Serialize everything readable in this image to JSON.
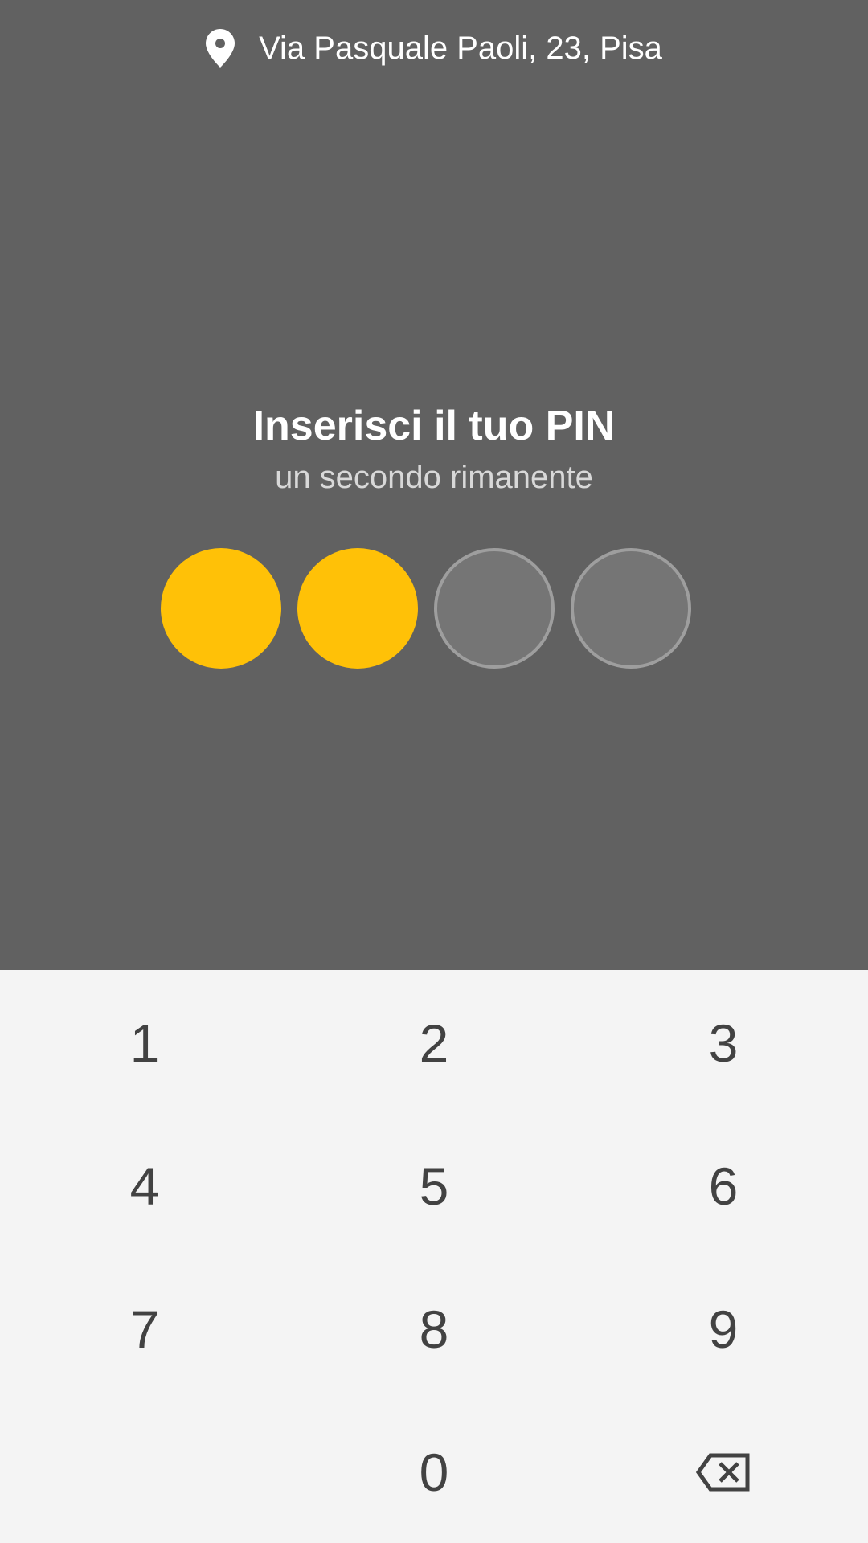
{
  "header": {
    "location_icon": "location-pin-icon",
    "location_text": "Via Pasquale Paoli, 23, Pisa"
  },
  "pin": {
    "title": "Inserisci il tuo PIN",
    "subtitle": "un secondo rimanente",
    "length": 4,
    "entered": 2,
    "filled_color": "#ffc107"
  },
  "keypad": {
    "keys": [
      "1",
      "2",
      "3",
      "4",
      "5",
      "6",
      "7",
      "8",
      "9",
      "0"
    ],
    "backspace_icon": "backspace-icon"
  },
  "colors": {
    "panel_background": "#616161",
    "keypad_background": "#f4f4f4",
    "key_text": "#424242"
  }
}
